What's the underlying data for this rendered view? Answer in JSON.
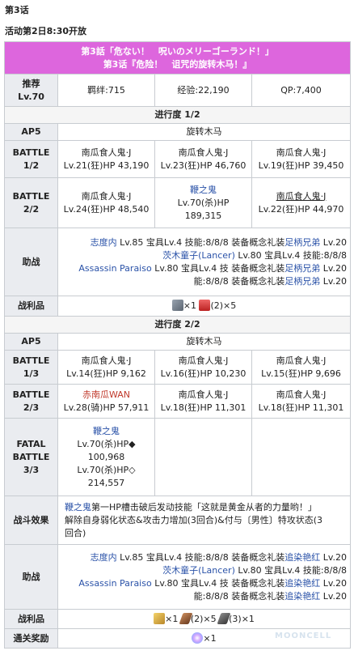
{
  "header": {
    "chapter": "第3话",
    "open_time": "活动第2日8:30开放"
  },
  "title": {
    "jp": "第3話「危ない！　呪いのメリーゴーランド！」",
    "cn": "第3话『危险！　诅咒的旋转木马！』"
  },
  "rec": {
    "label_a": "推荐",
    "label_b": "Lv.70",
    "bond": "羁绊:715",
    "exp": "经验:22,190",
    "qp": "QP:7,400"
  },
  "progress1": {
    "title": "进行度 1/2",
    "ap_label": "AP5",
    "location": "旋转木马",
    "battle1": {
      "label_a": "BATTLE",
      "label_b": "1/2",
      "enemies": [
        {
          "name": "南瓜食人鬼·J",
          "stats": "Lv.21(狂)HP 43,190"
        },
        {
          "name": "南瓜食人鬼·J",
          "stats": "Lv.23(狂)HP 46,760"
        },
        {
          "name": "南瓜食人鬼·J",
          "stats": "Lv.19(狂)HP 39,450"
        }
      ]
    },
    "battle2": {
      "label_a": "BATTLE",
      "label_b": "2/2",
      "e1_name": "南瓜食人鬼·J",
      "e1_stats": "Lv.24(狂)HP 48,540",
      "e2_name": "鞭之鬼",
      "e2_stats": "Lv.70(杀)HP",
      "e2_hp": "189,315",
      "e3_name": "南瓜食人鬼·J",
      "e3_stats": "Lv.22(狂)HP 44,970"
    },
    "support_label": "助战",
    "support": {
      "r1_name": "志度内",
      "r1_rest": " Lv.85 宝具Lv.4 技能:8/8/8",
      "r2_name": "茨木童子(Lancer)",
      "r2_rest": " Lv.80 宝具Lv.4 技能:8/8/8",
      "r3_name": "Assassin Paraiso",
      "r3_rest": " Lv.80 宝具Lv.4 技",
      "r4": "能:8/8/8",
      "ce_pre": "装备概念礼装",
      "ce_name": "足柄兄弟",
      "ce_lv": " Lv.20"
    },
    "drops_label": "战利品",
    "drop_count1": "×1",
    "drop_count2": "(2)×5"
  },
  "progress2": {
    "title": "进行度 2/2",
    "ap_label": "AP5",
    "location": "旋转木马",
    "battle1": {
      "label_a": "BATTLE",
      "label_b": "1/3",
      "enemies": [
        {
          "name": "南瓜食人鬼·J",
          "stats": "Lv.14(狂)HP 9,162"
        },
        {
          "name": "南瓜食人鬼·J",
          "stats": "Lv.16(狂)HP 10,230"
        },
        {
          "name": "南瓜食人鬼·J",
          "stats": "Lv.15(狂)HP 9,696"
        }
      ]
    },
    "battle2": {
      "label_a": "BATTLE",
      "label_b": "2/3",
      "e1_name": "赤南瓜WAN",
      "e1_stats": "Lv.28(骑)HP 57,911",
      "e2_name": "南瓜食人鬼·J",
      "e2_stats": "Lv.18(狂)HP 11,301",
      "e3_name": "南瓜食人鬼·J",
      "e3_stats": "Lv.18(狂)HP 11,301"
    },
    "battle3": {
      "label_a": "FATAL",
      "label_b": "BATTLE",
      "label_c": "3/3",
      "boss_name": "鞭之鬼",
      "hp1_stats": "Lv.70(杀)HP◆",
      "hp1_value": "100,968",
      "hp2_stats": "Lv.70(杀)HP◇",
      "hp2_value": "214,557"
    },
    "effect_label": "战斗效果",
    "effect": {
      "boss": "鞭之鬼",
      "line1": "第一HP槽击破后发动技能「这就是黄金从者的力量哟！」",
      "line2": "解除自身弱化状态&攻击力增加(3回合)&付与〔男性〕特攻状态(3",
      "line3": "回合)"
    },
    "support_label": "助战",
    "support": {
      "r1_name": "志度内",
      "r1_rest": " Lv.85 宝具Lv.4 技能:8/8/8",
      "r2_name": "茨木童子(Lancer)",
      "r2_rest": " Lv.80 宝具Lv.4 技能:8/8/8",
      "r3_name": "Assassin Paraiso",
      "r3_rest": " Lv.80 宝具Lv.4 技",
      "r4": "能:8/8/8",
      "ce_pre": "装备概念礼装",
      "ce_name": "追染艳红",
      "ce_lv": " Lv.20"
    },
    "drops_label": "战利品",
    "drop_count1": "×1",
    "drop_count2": "(2)×5",
    "drop_count3": "(3)×1",
    "clear_label": "通关奖励",
    "clear_count": "×1"
  },
  "watermark": "MOONCELL",
  "icons": {
    "drop_card": "ce-card-icon",
    "drop_cup": "grail-cup-icon",
    "drop_gold": "gold-material-icon",
    "drop_quill": "quill-icon",
    "clear_star": "saint-quartz-icon"
  },
  "colors": {
    "title_bg": "#dd66dd",
    "label_bg": "#eaecf0",
    "link": "#2a52a8",
    "red_name": "#c0392b"
  }
}
